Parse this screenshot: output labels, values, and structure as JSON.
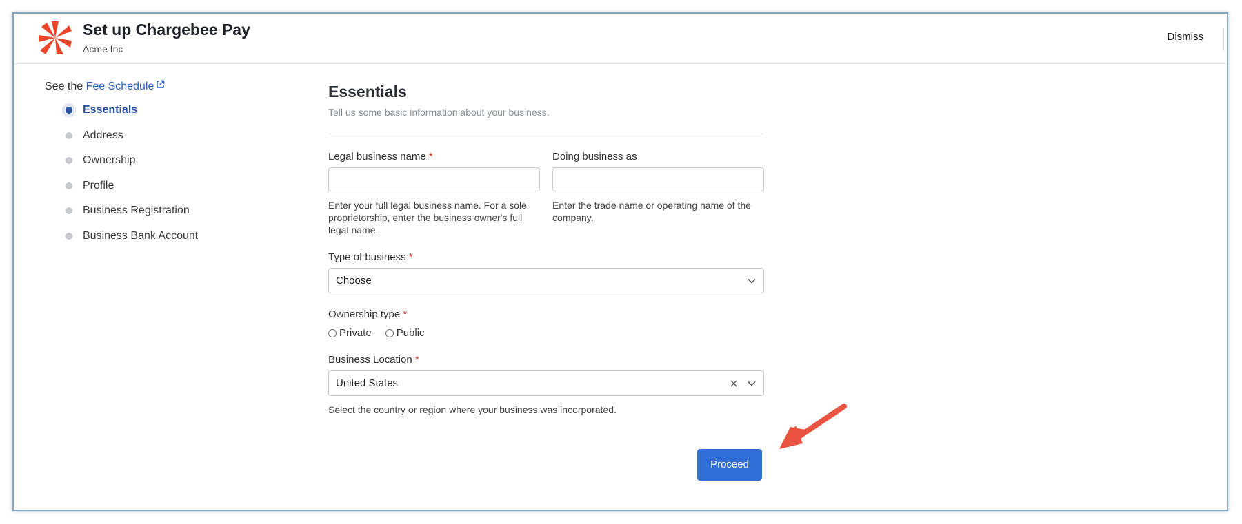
{
  "header": {
    "title": "Set up Chargebee Pay",
    "subtitle": "Acme Inc",
    "dismiss_label": "Dismiss",
    "logo_color": "#e8452a"
  },
  "sidebar": {
    "fee_prefix": "See the",
    "fee_link": "Fee Schedule",
    "steps": [
      {
        "label": "Essentials",
        "state": "active"
      },
      {
        "label": "Address",
        "state": "pending"
      },
      {
        "label": "Ownership",
        "state": "pending"
      },
      {
        "label": "Profile",
        "state": "pending"
      },
      {
        "label": "Business Registration",
        "state": "pending"
      },
      {
        "label": "Business Bank Account",
        "state": "pending"
      }
    ]
  },
  "form": {
    "title": "Essentials",
    "description": "Tell us some basic information about your business.",
    "legal_name": {
      "label": "Legal business name",
      "required": "*",
      "value": "",
      "help": "Enter your full legal business name. For a sole proprietorship, enter the business owner's full legal name."
    },
    "dba": {
      "label": "Doing business as",
      "value": "",
      "help": "Enter the trade name or operating name of the company."
    },
    "business_type": {
      "label": "Type of business",
      "required": "*",
      "value": "Choose"
    },
    "ownership": {
      "label": "Ownership type",
      "required": "*",
      "options": [
        "Private",
        "Public"
      ]
    },
    "location": {
      "label": "Business Location",
      "required": "*",
      "value": "United States",
      "help": "Select the country or region where your business was incorporated."
    },
    "proceed_label": "Proceed"
  },
  "colors": {
    "accent": "#2e6ed6",
    "active_step": "#2a52a4",
    "annotation_arrow": "#e8543f"
  }
}
